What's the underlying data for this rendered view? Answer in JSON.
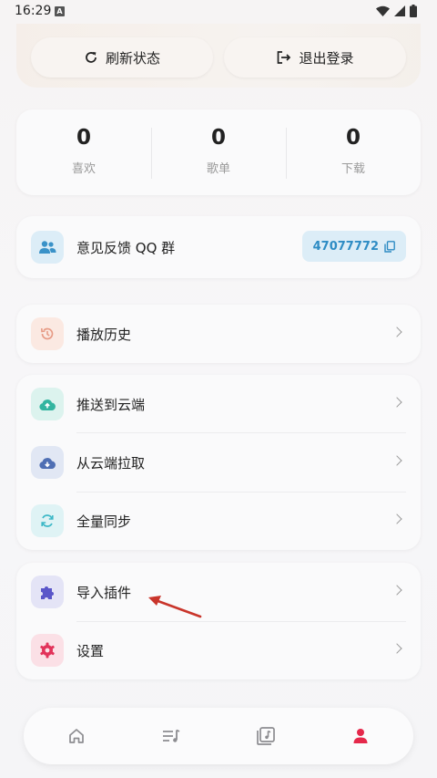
{
  "status": {
    "time": "16:29",
    "notif_icon": "A"
  },
  "actions": {
    "refresh_label": "刷新状态",
    "logout_label": "退出登录"
  },
  "stats": [
    {
      "value": "0",
      "label": "喜欢"
    },
    {
      "value": "0",
      "label": "歌单"
    },
    {
      "value": "0",
      "label": "下载"
    }
  ],
  "feedback": {
    "label": "意见反馈 QQ 群",
    "qq_number": "47077772"
  },
  "menu": {
    "history": "播放历史",
    "push": "推送到云端",
    "pull": "从云端拉取",
    "sync": "全量同步",
    "import_plugin": "导入插件",
    "settings": "设置"
  },
  "colors": {
    "accent_blue": "#2e8cc4",
    "active_tab": "#e5284b",
    "history_icon": "#e79b86",
    "cloud_up": "#33b5a0",
    "cloud_down": "#4f6fb4",
    "sync": "#3db8c7",
    "plugin": "#5a56c9",
    "settings": "#e2335a"
  },
  "tabs": [
    "home-icon",
    "playlist-icon",
    "library-icon",
    "profile-icon"
  ]
}
